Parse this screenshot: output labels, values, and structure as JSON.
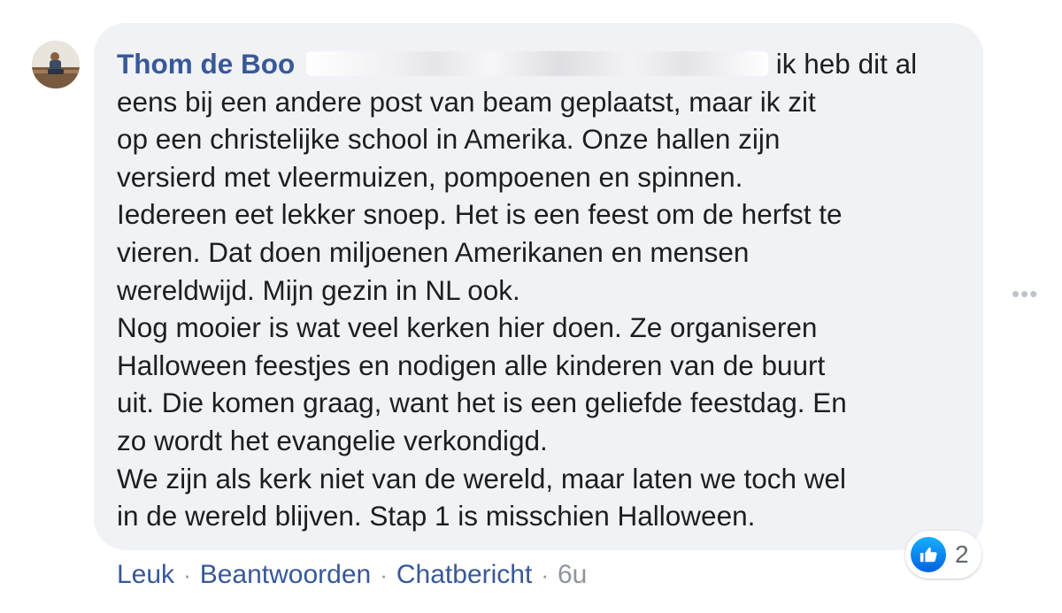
{
  "comment": {
    "author": "Thom de Boo",
    "first_line_tail": "ik heb dit al",
    "body": "eens bij een andere post van beam geplaatst, maar ik zit\nop een christelijke school in Amerika. Onze hallen zijn\nversierd met vleermuizen, pompoenen en spinnen.\nIedereen eet lekker snoep. Het is een feest om de herfst te\nvieren. Dat doen miljoenen Amerikanen en mensen\nwereldwijd. Mijn gezin in NL ook.\nNog mooier is wat veel kerken hier doen. Ze organiseren\nHalloween feestjes en nodigen alle kinderen van de buurt\nuit. Die komen graag, want het is een geliefde feestdag. En\nzo wordt het evangelie verkondigd.\nWe zijn als kerk niet van de wereld, maar laten we toch wel\nin de wereld blijven. Stap 1 is misschien Halloween."
  },
  "reactions": {
    "icon": "thumbs-up-icon",
    "count": "2",
    "color": "#1877f2"
  },
  "actions": {
    "like": "Leuk",
    "reply": "Beantwoorden",
    "message": "Chatbericht",
    "separator": "·",
    "time": "6u"
  },
  "more_icon": "more-options-icon",
  "colors": {
    "link": "#385898",
    "bubble": "#f0f2f5",
    "text": "#1c1e21",
    "meta": "#90949c"
  }
}
